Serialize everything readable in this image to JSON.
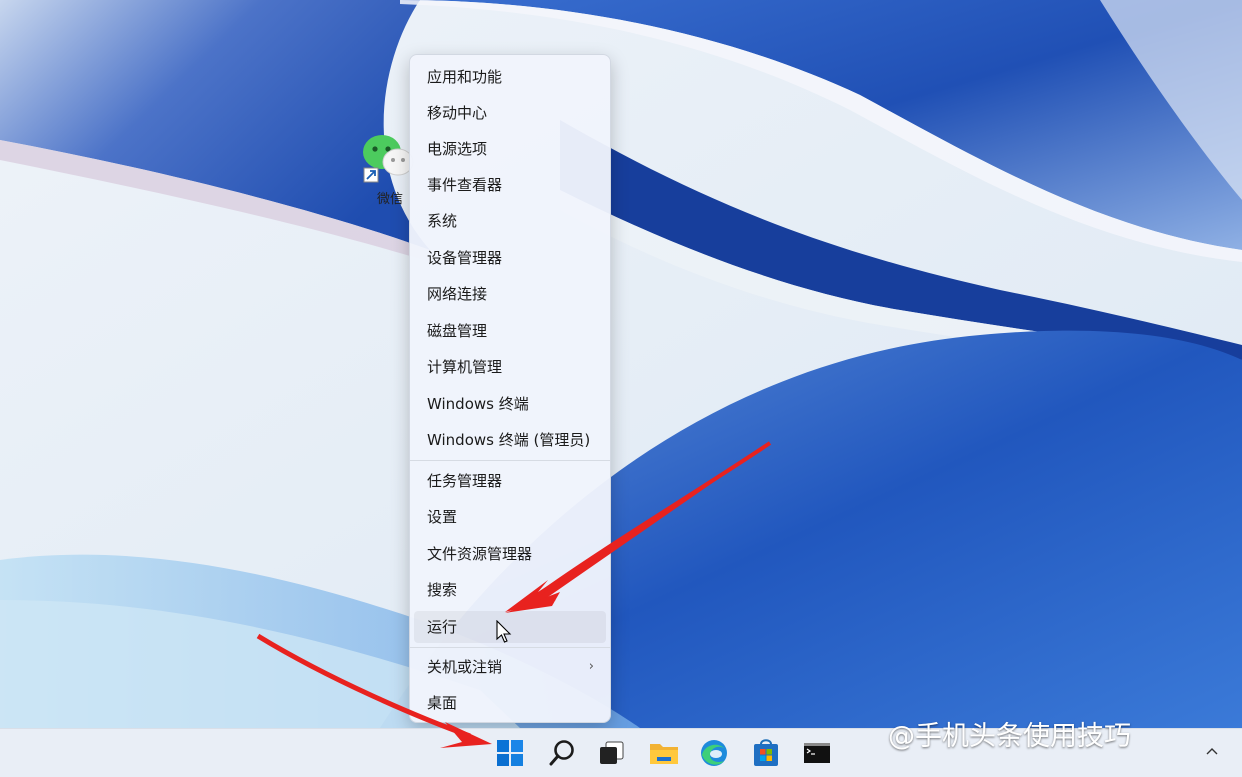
{
  "desktop": {
    "icons": [
      {
        "name": "微信",
        "icon": "wechat-icon"
      }
    ]
  },
  "context_menu": {
    "groups": [
      [
        "应用和功能",
        "移动中心",
        "电源选项",
        "事件查看器",
        "系统",
        "设备管理器",
        "网络连接",
        "磁盘管理",
        "计算机管理",
        "Windows 终端",
        "Windows 终端 (管理员)"
      ],
      [
        "任务管理器",
        "设置",
        "文件资源管理器",
        "搜索",
        "运行"
      ],
      [
        "关机或注销",
        "桌面"
      ]
    ],
    "hovered_item": "运行",
    "submenu_item": "关机或注销"
  },
  "taskbar": {
    "buttons": [
      "start-icon",
      "search-icon",
      "task-view-icon",
      "file-explorer-icon",
      "edge-icon",
      "store-icon",
      "terminal-icon"
    ],
    "tray_icon": "chevron-up-icon"
  },
  "watermark": "@手机头条使用技巧",
  "colors": {
    "accent": "#0078d4",
    "arrow": "#e8221f",
    "menu_bg": "#f0f4fc"
  }
}
